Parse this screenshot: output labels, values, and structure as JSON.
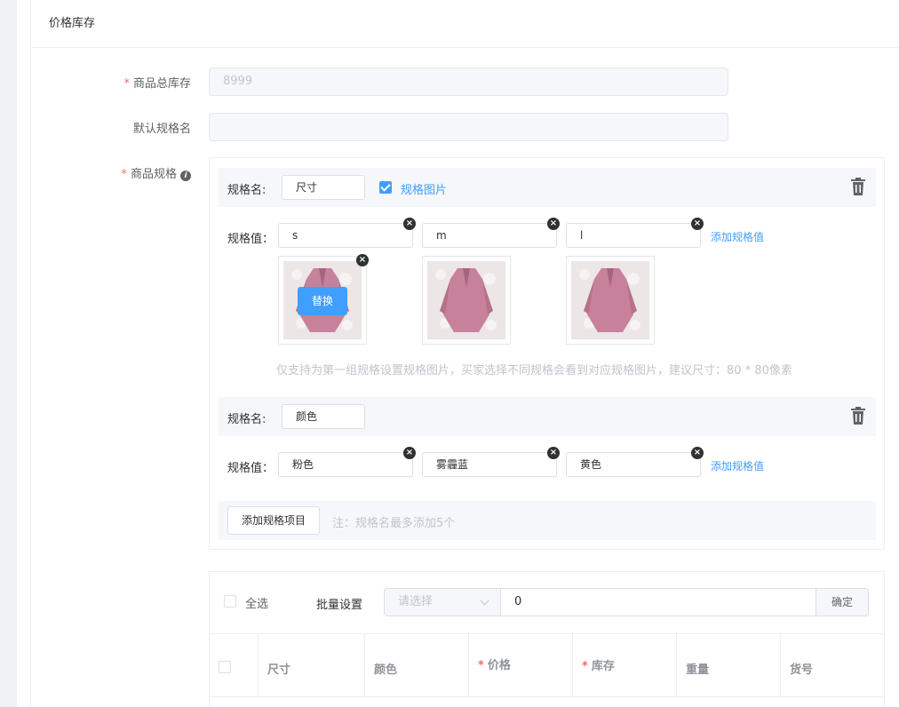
{
  "panel": {
    "title": "价格库存"
  },
  "form": {
    "total_stock": {
      "label": "商品总库存",
      "value": "8999"
    },
    "default_spec": {
      "label": "默认规格名",
      "value": ""
    },
    "spec_label": "商品规格"
  },
  "specs": [
    {
      "name_label": "规格名:",
      "name": "尺寸",
      "image_toggle_label": "规格图片",
      "value_label": "规格值：",
      "values": [
        "s",
        "m",
        "l"
      ],
      "add_value_label": "添加规格值",
      "replace_label": "替换",
      "hint": "仅支持为第一组规格设置规格图片，买家选择不同规格会看到对应规格图片，建议尺寸：80 * 80像素"
    },
    {
      "name_label": "规格名:",
      "name": "颜色",
      "value_label": "规格值：",
      "values": [
        "粉色",
        "雾霾蓝",
        "黄色"
      ],
      "add_value_label": "添加规格值"
    }
  ],
  "add_spec": {
    "button_label": "添加规格项目",
    "note": "注：规格名最多添加5个"
  },
  "batch": {
    "select_all_label": "全选",
    "batch_label": "批量设置",
    "select_placeholder": "请选择",
    "value": "0",
    "confirm_label": "确定"
  },
  "table": {
    "columns": [
      {
        "label": "尺寸",
        "required": false
      },
      {
        "label": "颜色",
        "required": false
      },
      {
        "label": "价格",
        "required": true
      },
      {
        "label": "库存",
        "required": true
      },
      {
        "label": "重量",
        "required": false
      },
      {
        "label": "货号",
        "required": false
      }
    ]
  },
  "colors": {
    "primary": "#409eff",
    "required": "#f56c6c",
    "coat": "#c7819b"
  }
}
